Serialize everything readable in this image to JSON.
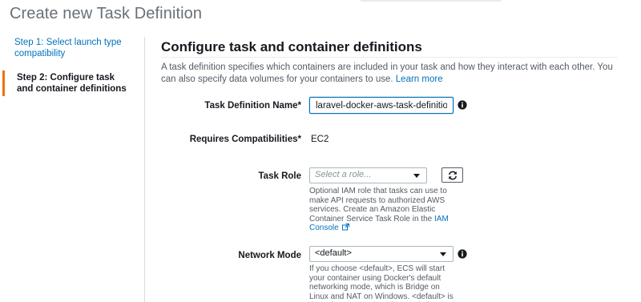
{
  "page": {
    "title": "Create new Task Definition"
  },
  "steps": [
    {
      "label": "Step 1: Select launch type compatibility"
    },
    {
      "label": "Step 2: Configure task and container definitions"
    }
  ],
  "section": {
    "title": "Configure task and container definitions",
    "description": "A task definition specifies which containers are included in your task and how they interact with each other. You can also specify data volumes for your containers to use.",
    "learn_more": "Learn more"
  },
  "form": {
    "task_definition_name": {
      "label": "Task Definition Name*",
      "value": "laravel-docker-aws-task-definition"
    },
    "requires_compatibilities": {
      "label": "Requires Compatibilities*",
      "value": "EC2"
    },
    "task_role": {
      "label": "Task Role",
      "placeholder": "Select a role...",
      "help": "Optional IAM role that tasks can use to make API requests to authorized AWS services. Create an Amazon Elastic Container Service Task Role in the",
      "help_link": "IAM Console"
    },
    "network_mode": {
      "label": "Network Mode",
      "value": "<default>",
      "help": "If you choose <default>, ECS will start your container using Docker's default networking mode, which is Bridge on Linux and NAT on Windows. <default> is the only supported mode on Windows."
    }
  },
  "icons": {
    "info": "info-circle-icon",
    "refresh": "refresh-icon",
    "external_link": "external-link-icon",
    "dropdown": "caret-down-icon"
  },
  "colors": {
    "link": "#0073bb",
    "step_active_marker": "#ec7211",
    "title_gray": "#687078"
  }
}
